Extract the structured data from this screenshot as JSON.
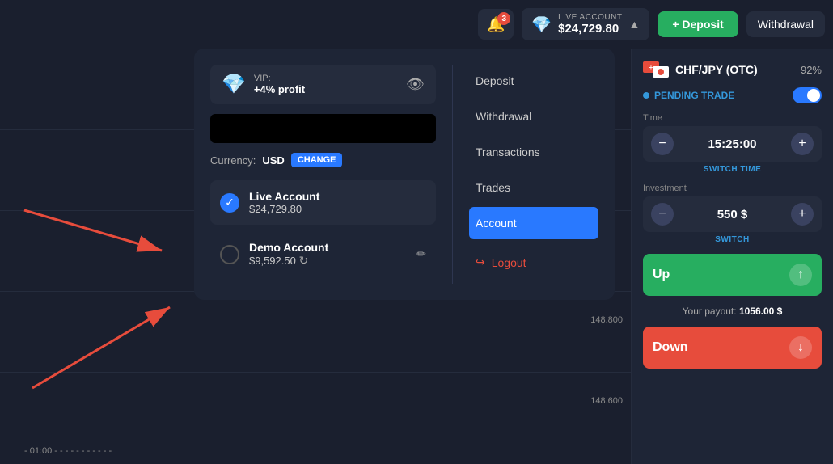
{
  "header": {
    "notification_count": "3",
    "account_type": "LIVE ACCOUNT",
    "account_balance": "$24,729.80",
    "deposit_label": "+ Deposit",
    "withdrawal_label": "Withdrawal"
  },
  "dropdown": {
    "vip_label": "VIP:",
    "vip_profit": "+4% profit",
    "currency_label": "Currency:",
    "currency_value": "USD",
    "change_btn": "CHANGE",
    "live_account_name": "Live Account",
    "live_account_balance": "$24,729.80",
    "demo_account_name": "Demo Account",
    "demo_account_balance": "$9,592.50"
  },
  "menu": {
    "deposit": "Deposit",
    "withdrawal": "Withdrawal",
    "transactions": "Transactions",
    "trades": "Trades",
    "account": "Account",
    "logout": "Logout"
  },
  "right_panel": {
    "pair_name": "CHF/JPY (OTC)",
    "pair_pct": "92%",
    "pending_trade": "PENDING TRADE",
    "time_label": "Time",
    "time_value": "15:25:00",
    "switch_time": "SWITCH TIME",
    "investment_label": "Investment",
    "investment_value": "550 $",
    "switch": "SWITCH",
    "up_label": "Up",
    "payout_label": "Your payout:",
    "payout_value": "1056.00 $",
    "down_label": "Down"
  },
  "chart": {
    "price_labels": [
      "148.800",
      "148.600"
    ],
    "time_label": "- 01:00 - - - - - - - - - - -"
  }
}
